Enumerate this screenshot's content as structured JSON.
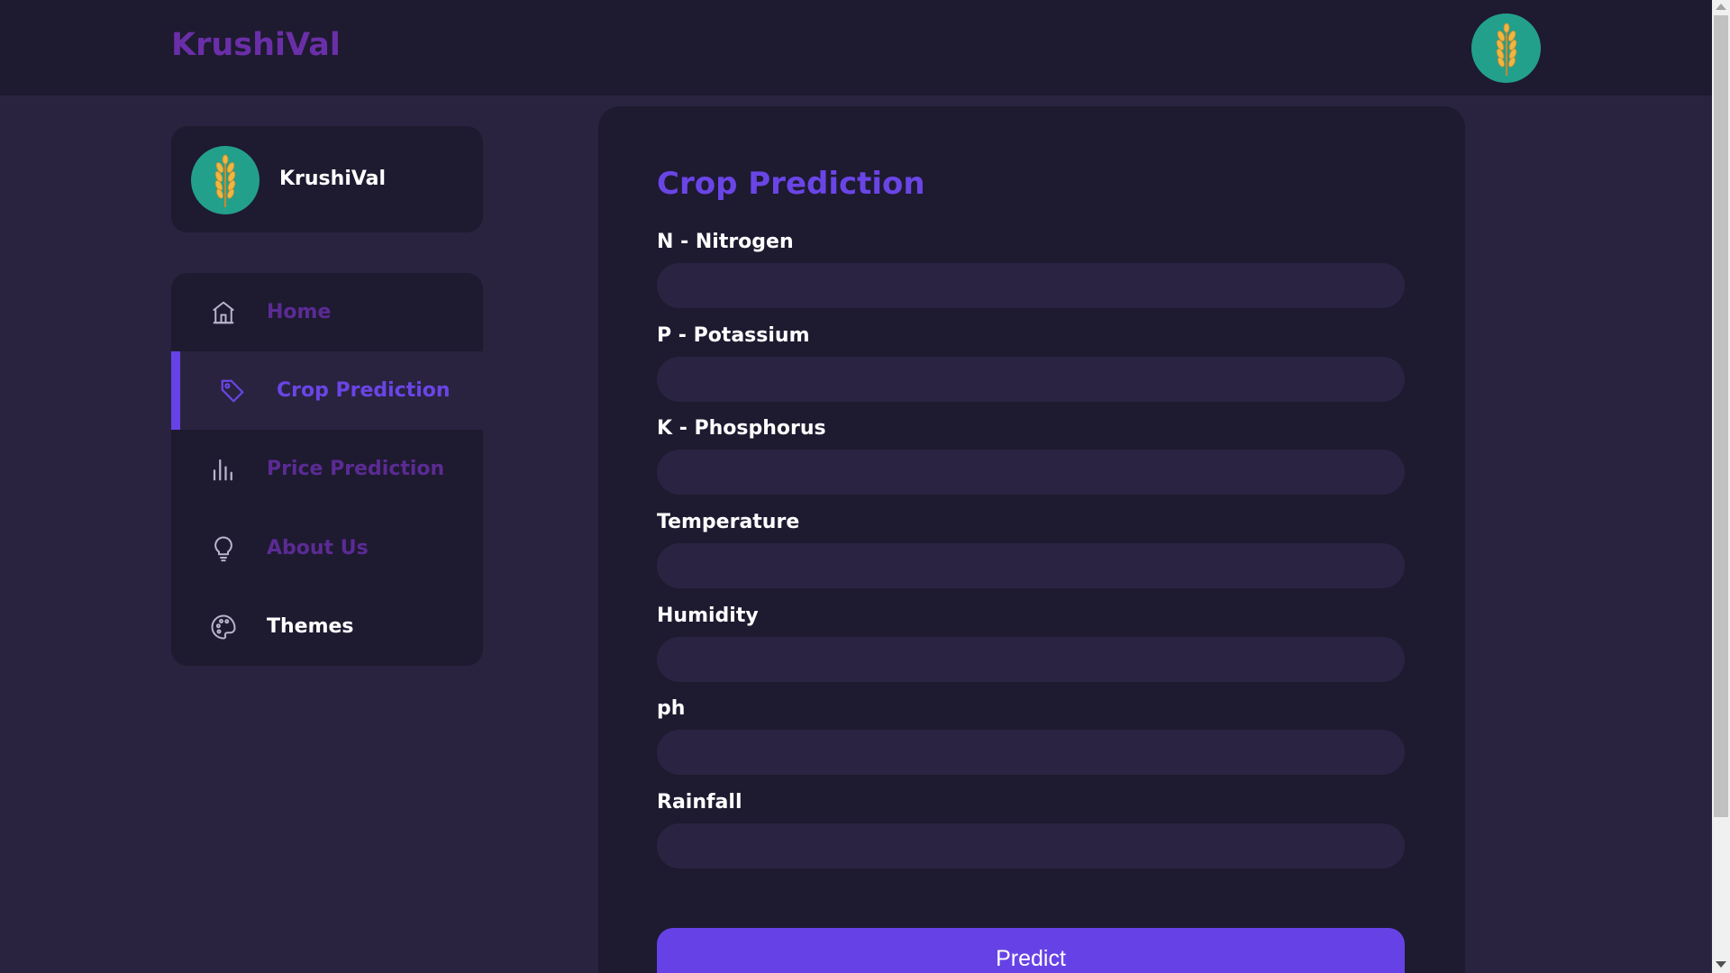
{
  "header": {
    "brand": "KrushiVal"
  },
  "profile": {
    "name": "KrushiVal"
  },
  "sidebar": {
    "items": [
      {
        "label": "Home",
        "icon": "home-icon",
        "color": "#5b2b94"
      },
      {
        "label": "Crop Prediction",
        "icon": "tag-icon",
        "color": "#6a45e6",
        "active": true
      },
      {
        "label": "Price Prediction",
        "icon": "bar-chart-icon",
        "color": "#5b2b94"
      },
      {
        "label": "About Us",
        "icon": "lightbulb-icon",
        "color": "#5b2b94"
      },
      {
        "label": "Themes",
        "icon": "palette-icon",
        "color": "#ffffff"
      }
    ]
  },
  "form": {
    "title": "Crop Prediction",
    "fields": [
      {
        "label": "N - Nitrogen",
        "value": ""
      },
      {
        "label": "P - Potassium",
        "value": ""
      },
      {
        "label": "K - Phosphorus",
        "value": ""
      },
      {
        "label": "Temperature",
        "value": ""
      },
      {
        "label": "Humidity",
        "value": ""
      },
      {
        "label": "ph",
        "value": ""
      },
      {
        "label": "Rainfall",
        "value": ""
      }
    ],
    "submit_label": "Predict"
  },
  "colors": {
    "background": "#29233f",
    "surface": "#1e1a30",
    "accent": "#6642e6",
    "brand": "#6a2fa8",
    "input": "#2a2442",
    "avatar": "#23a08c"
  }
}
